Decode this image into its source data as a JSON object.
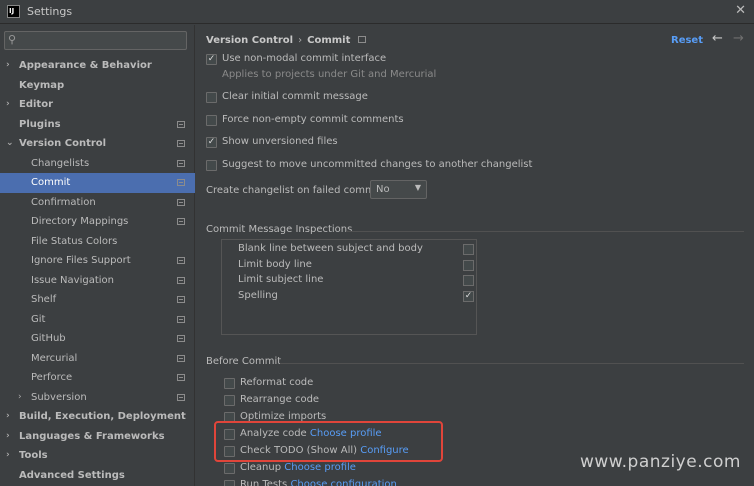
{
  "window": {
    "title": "Settings",
    "logo_text": "IJ"
  },
  "sidebar": {
    "search": {
      "value": "",
      "placeholder": ""
    },
    "items": [
      {
        "label": "Appearance & Behavior",
        "arrow": "›",
        "bold": true,
        "level": 0,
        "proj": false,
        "selected": false
      },
      {
        "label": "Keymap",
        "arrow": "",
        "bold": true,
        "level": 0,
        "proj": false,
        "selected": false
      },
      {
        "label": "Editor",
        "arrow": "›",
        "bold": true,
        "level": 0,
        "proj": false,
        "selected": false
      },
      {
        "label": "Plugins",
        "arrow": "",
        "bold": true,
        "level": 0,
        "proj": true,
        "selected": false
      },
      {
        "label": "Version Control",
        "arrow": "⌄",
        "bold": true,
        "level": 0,
        "proj": true,
        "selected": false
      },
      {
        "label": "Changelists",
        "arrow": "",
        "bold": false,
        "level": 1,
        "proj": true,
        "selected": false
      },
      {
        "label": "Commit",
        "arrow": "",
        "bold": false,
        "level": 1,
        "proj": true,
        "selected": true
      },
      {
        "label": "Confirmation",
        "arrow": "",
        "bold": false,
        "level": 1,
        "proj": true,
        "selected": false
      },
      {
        "label": "Directory Mappings",
        "arrow": "",
        "bold": false,
        "level": 1,
        "proj": true,
        "selected": false
      },
      {
        "label": "File Status Colors",
        "arrow": "",
        "bold": false,
        "level": 1,
        "proj": false,
        "selected": false
      },
      {
        "label": "Ignore Files Support",
        "arrow": "",
        "bold": false,
        "level": 1,
        "proj": true,
        "selected": false
      },
      {
        "label": "Issue Navigation",
        "arrow": "",
        "bold": false,
        "level": 1,
        "proj": true,
        "selected": false
      },
      {
        "label": "Shelf",
        "arrow": "",
        "bold": false,
        "level": 1,
        "proj": true,
        "selected": false
      },
      {
        "label": "Git",
        "arrow": "",
        "bold": false,
        "level": 1,
        "proj": true,
        "selected": false
      },
      {
        "label": "GitHub",
        "arrow": "",
        "bold": false,
        "level": 1,
        "proj": true,
        "selected": false
      },
      {
        "label": "Mercurial",
        "arrow": "",
        "bold": false,
        "level": 1,
        "proj": true,
        "selected": false
      },
      {
        "label": "Perforce",
        "arrow": "",
        "bold": false,
        "level": 1,
        "proj": true,
        "selected": false
      },
      {
        "label": "Subversion",
        "arrow": "›",
        "bold": false,
        "level": 1,
        "proj": true,
        "selected": false
      },
      {
        "label": "Build, Execution, Deployment",
        "arrow": "›",
        "bold": true,
        "level": 0,
        "proj": false,
        "selected": false
      },
      {
        "label": "Languages & Frameworks",
        "arrow": "›",
        "bold": true,
        "level": 0,
        "proj": false,
        "selected": false
      },
      {
        "label": "Tools",
        "arrow": "›",
        "bold": true,
        "level": 0,
        "proj": false,
        "selected": false
      },
      {
        "label": "Advanced Settings",
        "arrow": "",
        "bold": true,
        "level": 0,
        "proj": false,
        "selected": false
      }
    ]
  },
  "header": {
    "breadcrumb_parent": "Version Control",
    "breadcrumb_sep": "›",
    "breadcrumb_current": "Commit",
    "reset_label": "Reset"
  },
  "commit": {
    "non_modal": {
      "label": "Use non-modal commit interface",
      "checked": true
    },
    "non_modal_hint": "Applies to projects under Git and Mercurial",
    "clear_initial": {
      "label": "Clear initial commit message",
      "checked": false
    },
    "force_non_empty": {
      "label": "Force non-empty commit comments",
      "checked": false
    },
    "show_unversioned": {
      "label": "Show unversioned files",
      "checked": true
    },
    "suggest_move": {
      "label": "Suggest to move uncommitted changes to another changelist",
      "checked": false
    },
    "changelist_label": "Create changelist on failed commit:",
    "changelist_value": "No"
  },
  "inspections": {
    "title": "Commit Message Inspections",
    "items": [
      {
        "label": "Blank line between subject and body",
        "checked": false
      },
      {
        "label": "Limit body line",
        "checked": false
      },
      {
        "label": "Limit subject line",
        "checked": false
      },
      {
        "label": "Spelling",
        "checked": true
      }
    ]
  },
  "before_commit": {
    "title": "Before Commit",
    "items": [
      {
        "label": "Reformat code",
        "link": "",
        "checked": false
      },
      {
        "label": "Rearrange code",
        "link": "",
        "checked": false
      },
      {
        "label": "Optimize imports",
        "link": "",
        "checked": false
      },
      {
        "label": "Analyze code",
        "link": "Choose profile",
        "checked": false
      },
      {
        "label": "Check TODO (Show All)",
        "link": "Configure",
        "checked": false
      },
      {
        "label": "Cleanup",
        "link": "Choose profile",
        "checked": false
      },
      {
        "label": "Run Tests",
        "link": "Choose configuration",
        "checked": false
      }
    ]
  },
  "watermark": "www.panziye.com",
  "colors": {
    "selection": "#4b6eaf",
    "link": "#589df6",
    "highlight": "#e0453a",
    "background": "#3c3f41"
  }
}
